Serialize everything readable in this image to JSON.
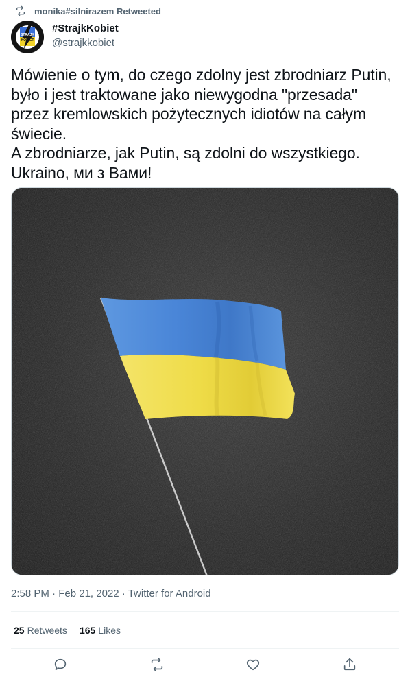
{
  "retweet_header": {
    "label": "monika#silnirazem Retweeted",
    "icon": "retweet-icon"
  },
  "author": {
    "display_name": "#StrajkKobiet",
    "handle": "@strajkkobiet",
    "avatar_logo_text": "STRAJK KOBIET"
  },
  "tweet": {
    "text": "Mówienie o tym, do czego zdolny jest zbrodniarz Putin,\nbyło i jest  traktowane jako niewygodna \"przesada\"\nprzez kremlowskich pożytecznych idiotów na całym\nświecie.\nA zbrodniarze, jak Putin, są zdolni do wszystkiego.\nUkraino, ми з Вами!",
    "media": {
      "description_icon": "ukrainian-flag-photo",
      "flag_colors": [
        "#4a86d8",
        "#f2e04a"
      ]
    }
  },
  "meta": {
    "time": "2:58 PM",
    "separator1": "·",
    "date": "Feb 21, 2022",
    "separator2": "·",
    "source": "Twitter for Android"
  },
  "stats": {
    "retweets_count": "25",
    "retweets_label": "Retweets",
    "likes_count": "165",
    "likes_label": "Likes"
  },
  "actions": {
    "reply_icon": "reply-icon",
    "retweet_icon": "retweet-icon",
    "like_icon": "heart-icon",
    "share_icon": "share-icon"
  },
  "colors": {
    "secondary_text": "#536471",
    "primary_text": "#0f1419",
    "divider": "#eff3f4"
  }
}
